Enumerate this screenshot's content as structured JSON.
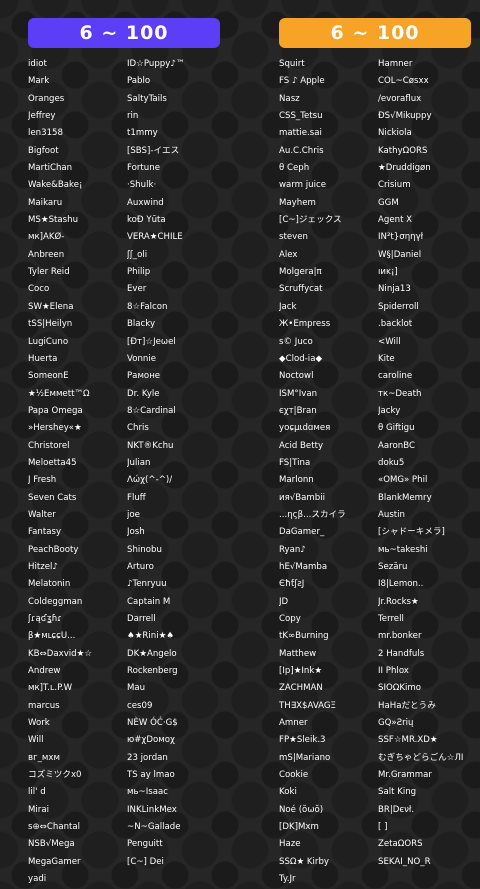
{
  "panels": [
    {
      "title": "6 ~ 100",
      "color": "#5b3ef5",
      "columns": [
        [
          "idiot",
          "Mark",
          "Oranges",
          "Jeffrey",
          "len3158",
          "Bigfoot",
          "MartiChan",
          "Wake&Bake¡",
          "Maikaru",
          "MS★Stashu",
          "мк]AKØ-",
          "Anbreen",
          "Tyler Reid",
          "Coco",
          "SW★Elena",
          "tSS|Heilyn",
          "LugiCuno",
          "Huerta",
          "SomeonE",
          "★½Eммett™Ω",
          "Papa Omega",
          "»Hershey«★",
          "Christorel",
          "Meloetta45",
          "J Fresh",
          "Seven Cats",
          "Walter",
          "Fantasy",
          "PeachBooty",
          "Hitzel♪",
          "Melatonin",
          "Coldeggman",
          "ʃɾąʛʓɦɾ",
          "β★мւɕɕU...",
          "KB⇔Daxvid★☆",
          "Andrew",
          "мк]T.ʟ.P.W",
          "marcus",
          "Work",
          "Will",
          "вг_мхм",
          "コズミツクx0",
          "lil' d",
          "Mirai",
          "s⊕⇔Chantal",
          "NSB√Mega",
          "MegaGamer",
          "yadi"
        ],
        [
          "ID☆Puppy♪™",
          "Pablo",
          "SaltyTails",
          "rin",
          "t1mmy",
          "[SBS]-イエス",
          "Fortune",
          "·Shulk·",
          "Auxwind",
          "koĐ Yūta",
          "VERA★CHILE",
          "ʃʃ_oli",
          "Philip",
          "Ever",
          "8☆Falcon",
          "Blacky",
          "[Đт]☆Jeωel",
          "Vonnie",
          "Рамоне",
          "Dr. Kyle",
          "8☆Cardinal",
          "Chris",
          "NKT®Kchu",
          "Julian",
          "Λώχ(^-^)/",
          "Fluff",
          "joe",
          "Josh",
          "Shinobu",
          "Arturo",
          "♪Tenryuu",
          "Captain M",
          "Darrell",
          "♠★Rini★♠",
          "DK★Angelo",
          "Rockenberg",
          "Mau",
          "ces09",
          "NÈW ÓĆ·G$",
          "ю#χDoмoχ",
          "23 jordan",
          "TS ay lmao",
          "мь~Isaac",
          "INKLinkMex",
          "~N~Gallade",
          "Penguitt",
          "[C~] Dei"
        ]
      ]
    },
    {
      "title": "6 ~ 100",
      "color": "#f7a326",
      "columns": [
        [
          "Squirt",
          "FS ♪ Apple",
          "Nasz",
          "CSS_Tetsu",
          "mattie.sai",
          "Au.C.Chris",
          "θ Ceph",
          "warm juice",
          "Mayhem",
          "[C~]ジェックス",
          "steven",
          "Alex",
          "Molgera|π",
          "Scruffycat",
          "Jack",
          "Ж•Empress",
          "s© Juco",
          "◆Clod-ia◆",
          "Noctowl",
          "ISM°Ivan",
          "єχт|Bran",
          "уoɕµɩdɑмея",
          "Acid Betty",
          "FS|Tina",
          "Marlonn",
          "ия√Bambii",
          "...ηςβ...スカイラ",
          "DaGamer_",
          "Ryan♪",
          "hE√Mamba",
          "ЄħƭʃƨJ",
          "JD",
          "Copy",
          "tK∞Burning",
          "Matthew",
          "[Ip]★Ink★",
          "ZACHMAN",
          "TH∃X$AVAGΞ",
          "Amner",
          "FP★Sleik.3",
          "mS|Mariano",
          "Cookie",
          "Koki",
          "Noé (ŏωŏ)",
          "[DK]Mxm",
          "Haze",
          "SSΩ★ Kirby",
          "Ty.Jr"
        ],
        [
          "Hamner",
          "COL~Cøsxx",
          "/evoraflux",
          "ÐS√Mikuppy",
          "Nickiola",
          "KathyΩORS",
          "★Druddigøn",
          "Crisium",
          "GGM",
          "Agent X",
          "IN²t}σηηγł",
          "W§|Daniel",
          "ıиĸ¡]",
          "Ninja13",
          "Spiderroll",
          ".backlot",
          "<Will",
          "Kite",
          "caroline",
          "тк~Death",
          "Jacky",
          "θ Giftigu",
          "AaronBC",
          "doku5",
          "«OMG» Phil",
          "BlankMemry",
          "Austin",
          "[シャドーキメラ]",
          "мь~takeshi",
          "Sezāru",
          "I8|Lemon..",
          "Jr.Rocks★",
          "Terrell",
          "mr.bonker",
          "2 Handfuls",
          "II Phlox",
          "SIOΩKimo",
          "HaHaだとうみ",
          "GQ»Ƨrių",
          "SSF☆MR.XD★",
          "むぎちゃどらごん☆ЛI",
          "Mr.Grammar",
          "Salt King",
          "BR|Dєνł.",
          "[ ]",
          "ZetaΩORS",
          "SEKAI_NO_R"
        ]
      ]
    }
  ]
}
